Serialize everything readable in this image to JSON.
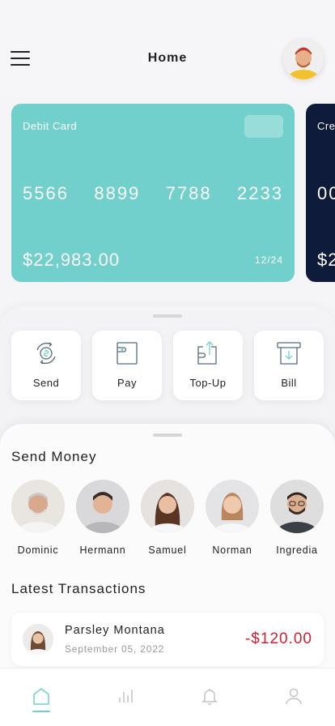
{
  "header": {
    "title": "Home"
  },
  "cards": [
    {
      "label": "Debit Card",
      "number": [
        "5566",
        "8899",
        "7788",
        "2233"
      ],
      "balance": "$22,983.00",
      "expiry": "12/24",
      "color": "#72d0cc"
    },
    {
      "label": "Cre",
      "number": [
        "00"
      ],
      "balance": "$2",
      "color": "#0f1b3a"
    }
  ],
  "actions": [
    {
      "label": "Send",
      "icon": "send-money-icon"
    },
    {
      "label": "Pay",
      "icon": "wallet-icon"
    },
    {
      "label": "Top-Up",
      "icon": "top-up-icon"
    },
    {
      "label": "Bill",
      "icon": "bill-icon"
    }
  ],
  "send_money": {
    "title": "Send Money",
    "contacts": [
      {
        "name": "Dominic"
      },
      {
        "name": "Hermann"
      },
      {
        "name": "Samuel"
      },
      {
        "name": "Norman"
      },
      {
        "name": "Ingredia"
      }
    ]
  },
  "transactions": {
    "title": "Latest Transactions",
    "items": [
      {
        "name": "Parsley Montana",
        "date": "September 05, 2022",
        "amount": "-$120.00"
      }
    ]
  },
  "tabbar": {
    "items": [
      {
        "icon": "home-icon",
        "active": true
      },
      {
        "icon": "stats-icon",
        "active": false
      },
      {
        "icon": "bell-icon",
        "active": false
      },
      {
        "icon": "profile-icon",
        "active": false
      }
    ],
    "accent": "#72d0cc"
  },
  "colors": {
    "negative_amount": "#cf2030",
    "debit_card": "#72d0cc",
    "credit_card": "#0f1b3a"
  }
}
